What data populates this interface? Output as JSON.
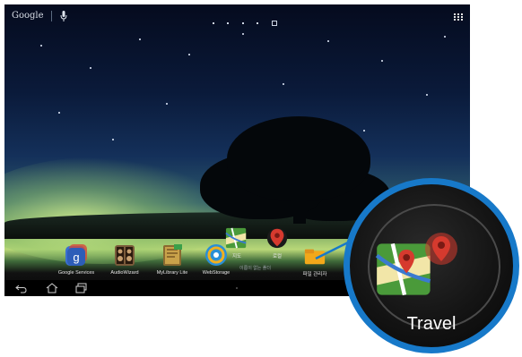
{
  "statusbar": {
    "search_label": "Google",
    "mic_icon": "mic-icon",
    "page_indicator_count": 5,
    "page_indicator_active": 4,
    "apps_icon": "all-apps-icon"
  },
  "dock": {
    "apps": [
      {
        "label": "Google Services",
        "icon": "google-services-icon",
        "color": "#3b6fd1"
      },
      {
        "label": "AudioWizard",
        "icon": "audiowizard-icon",
        "color": "#6b4a2a"
      },
      {
        "label": "MyLibrary Lite",
        "icon": "mylibrary-icon",
        "color": "#7a5a2a"
      },
      {
        "label": "WebStorage",
        "icon": "webstorage-icon",
        "color": "#2a8fd6"
      }
    ],
    "folder": {
      "apps": [
        {
          "label": "지도",
          "icon": "maps-icon"
        },
        {
          "label": "로컬",
          "icon": "local-icon"
        }
      ],
      "name_placeholder": "이름이 없는 폴더"
    },
    "partial_app": {
      "label": "파일 관리자",
      "icon": "file-manager-icon"
    }
  },
  "navbar": {
    "back_icon": "back-icon",
    "home_icon": "home-icon",
    "recents_icon": "recent-apps-icon"
  },
  "callout": {
    "label": "Travel",
    "ring_color": "#1779c9",
    "icons": [
      "maps-icon",
      "local-icon"
    ]
  }
}
